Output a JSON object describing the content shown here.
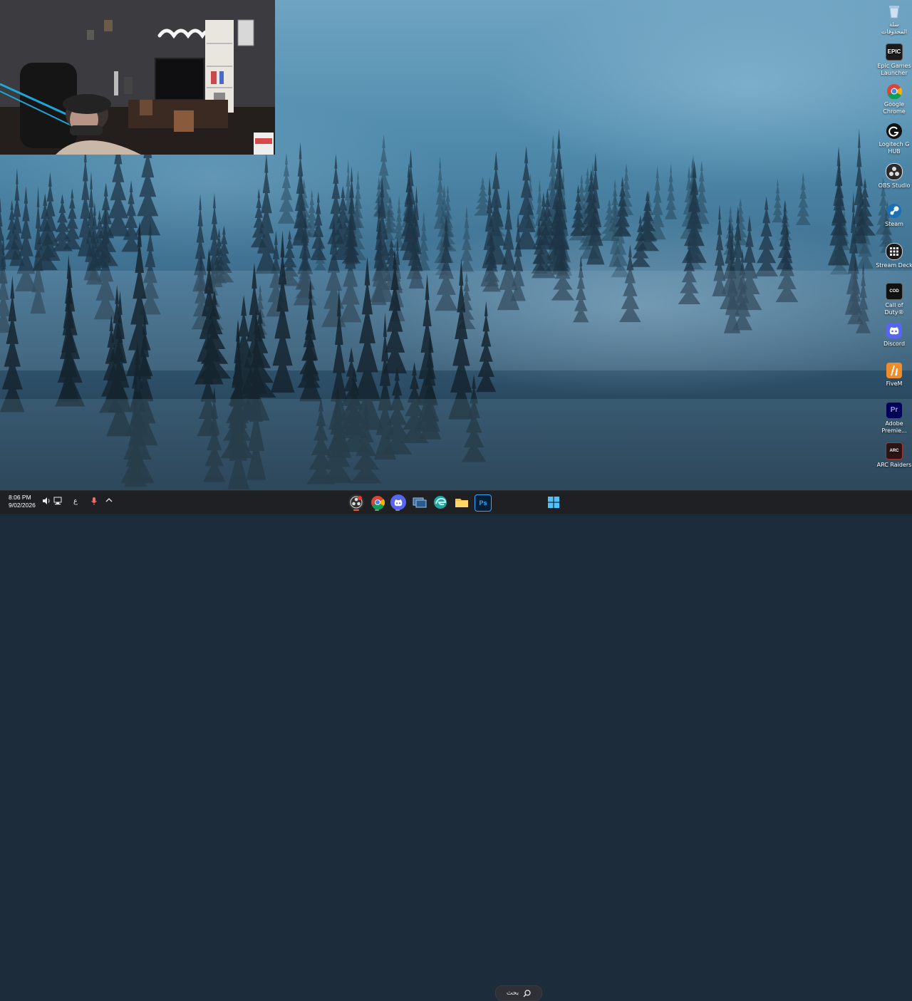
{
  "desktop_icons": [
    {
      "label": "سلة المحذوفات",
      "icon": "recycle-bin-icon",
      "color": "#8fb3d9"
    },
    {
      "label": "Epic Games Launcher",
      "icon": "epic-games-icon",
      "color": "#1b1b1b"
    },
    {
      "label": "Google Chrome",
      "icon": "chrome-icon",
      "color": "#db4437"
    },
    {
      "label": "Logitech G HUB",
      "icon": "logitech-g-hub-icon",
      "color": "#111111"
    },
    {
      "label": "OBS Studio",
      "icon": "obs-studio-icon",
      "color": "#2a2a2a"
    },
    {
      "label": "Steam",
      "icon": "steam-icon",
      "color": "#1b2838"
    },
    {
      "label": "Stream Deck",
      "icon": "stream-deck-icon",
      "color": "#1a1a1a"
    },
    {
      "label": "Call of Duty®",
      "icon": "call-of-duty-icon",
      "color": "#111111"
    },
    {
      "label": "Discord",
      "icon": "discord-icon",
      "color": "#5865f2"
    },
    {
      "label": "FiveM",
      "icon": "fivem-icon",
      "color": "#f28c28"
    },
    {
      "label": "Adobe Premie...",
      "icon": "adobe-premiere-icon",
      "color": "#00005b"
    },
    {
      "label": "ARC Raiders",
      "icon": "arc-raiders-icon",
      "color": "#7a1a1a"
    }
  ],
  "icon_glyphs": {
    "epic": "EPIC",
    "premiere": "Pr",
    "photoshop": "Ps",
    "cod": "COD",
    "arc": "ARC"
  },
  "taskbar": {
    "clock": {
      "time": "8:06 PM",
      "date": "9/02/2026"
    },
    "tray": {
      "language": "ع"
    },
    "search": {
      "label": "بحث"
    },
    "apps": [
      {
        "icon": "obs-studio-icon",
        "color": "#303030"
      },
      {
        "icon": "chrome-icon",
        "color": "#db4437"
      },
      {
        "icon": "discord-icon",
        "color": "#5865f2"
      },
      {
        "icon": "task-view-icon",
        "color": "#3a6ea5"
      },
      {
        "icon": "edge-icon",
        "color": "#1fa6a0"
      },
      {
        "icon": "file-explorer-icon",
        "color": "#f4c542"
      },
      {
        "icon": "photoshop-icon",
        "color": "#001e36"
      },
      {
        "icon": "windows-start-icon",
        "color": "#3aa0f3"
      }
    ]
  }
}
